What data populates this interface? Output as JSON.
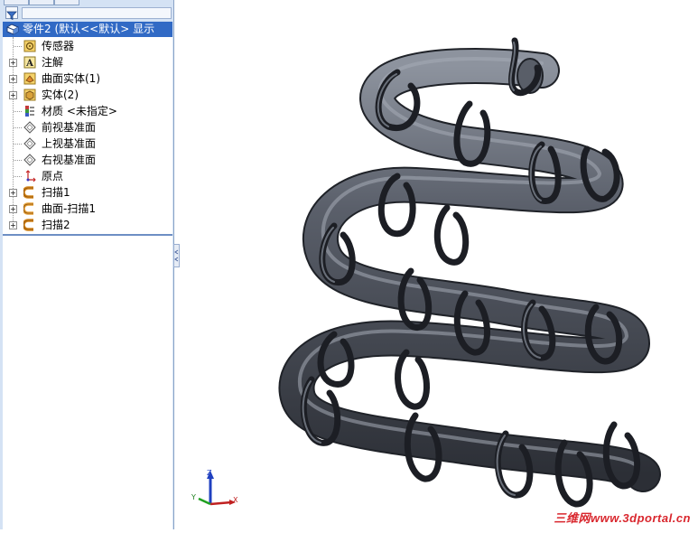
{
  "feature_tree": {
    "root": {
      "label": "零件2  (默认<<默认> 显示",
      "icon": "part-icon"
    },
    "items": [
      {
        "label": "传感器",
        "icon": "sensor-icon",
        "expandable": false
      },
      {
        "label": "注解",
        "icon": "annotation-icon",
        "expandable": true
      },
      {
        "label": "曲面实体(1)",
        "icon": "surface-bodies-icon",
        "expandable": true
      },
      {
        "label": "实体(2)",
        "icon": "solid-bodies-icon",
        "expandable": true
      },
      {
        "label": "材质 <未指定>",
        "icon": "material-icon",
        "expandable": false
      },
      {
        "label": "前视基准面",
        "icon": "plane-icon",
        "expandable": false
      },
      {
        "label": "上视基准面",
        "icon": "plane-icon",
        "expandable": false
      },
      {
        "label": "右视基准面",
        "icon": "plane-icon",
        "expandable": false
      },
      {
        "label": "原点",
        "icon": "origin-icon",
        "expandable": false
      },
      {
        "label": "扫描1",
        "icon": "sweep-icon",
        "expandable": true
      },
      {
        "label": "曲面-扫描1",
        "icon": "surface-sweep-icon",
        "expandable": true
      },
      {
        "label": "扫描2",
        "icon": "sweep-icon",
        "expandable": true
      }
    ]
  },
  "triad": {
    "x": "X",
    "y": "Y",
    "z": "Z"
  },
  "watermark": "三维网www.3dportal.cn",
  "colors": {
    "selection": "#316ac5",
    "pane": "#d4e2f4",
    "model": "#4a4e58",
    "watermark": "#d9262d"
  }
}
